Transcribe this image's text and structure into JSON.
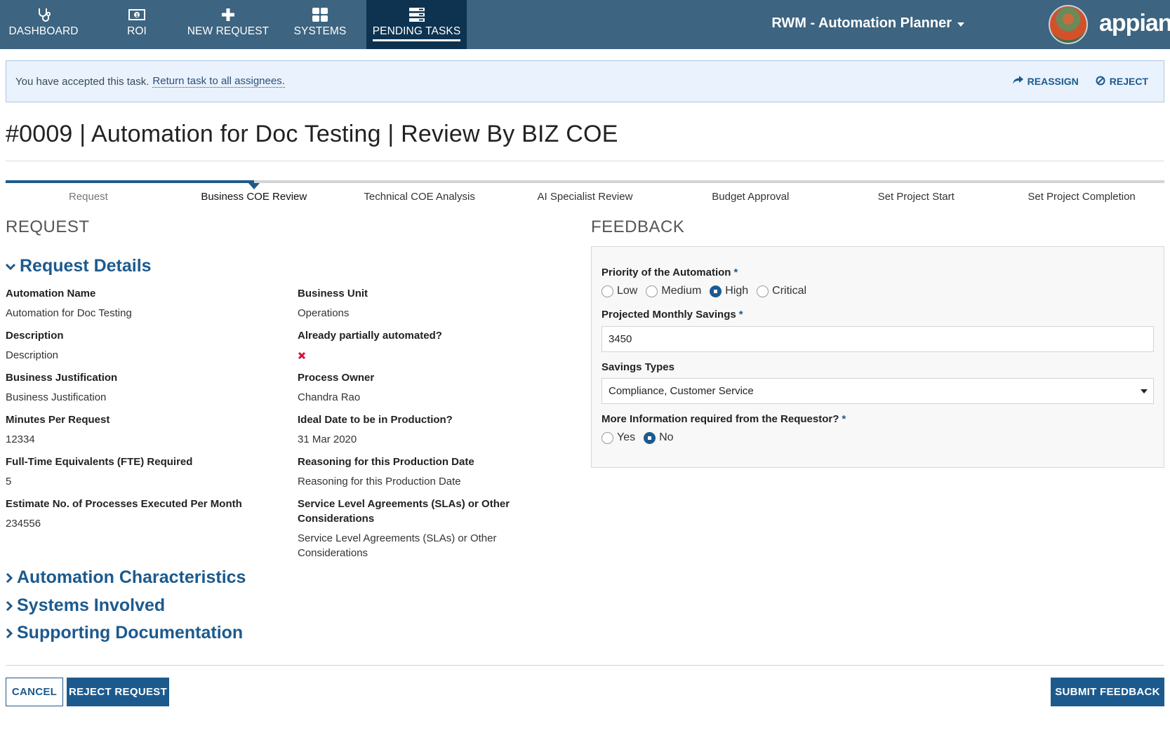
{
  "nav": {
    "tabs": [
      {
        "label": "DASHBOARD",
        "icon": "stethoscope-icon",
        "active": false
      },
      {
        "label": "ROI",
        "icon": "money-icon",
        "active": false
      },
      {
        "label": "NEW REQUEST",
        "icon": "plus-icon",
        "active": false
      },
      {
        "label": "SYSTEMS",
        "icon": "grid-icon",
        "active": false
      },
      {
        "label": "PENDING TASKS",
        "icon": "tasks-list-icon",
        "active": true
      }
    ],
    "app_title": "RWM - Automation Planner",
    "logo": "appian"
  },
  "banner": {
    "text": "You have accepted this task.",
    "link": "Return task to all assignees.",
    "reassign": "REASSIGN",
    "reject": "REJECT"
  },
  "page_title": "#0009 | Automation for Doc Testing | Review By BIZ COE",
  "steps": {
    "items": [
      "Request",
      "Business COE Review",
      "Technical COE Analysis",
      "AI Specialist Review",
      "Budget Approval",
      "Set Project Start",
      "Set Project Completion"
    ],
    "current_index": 1
  },
  "request": {
    "heading": "REQUEST",
    "details_heading": "Request Details",
    "left_fields": [
      {
        "label": "Automation Name",
        "value": "Automation for Doc Testing"
      },
      {
        "label": "Description",
        "value": "Description"
      },
      {
        "label": "Business Justification",
        "value": "Business Justification"
      },
      {
        "label": "Minutes Per Request",
        "value": "12334"
      },
      {
        "label": "Full-Time Equivalents (FTE) Required",
        "value": "5"
      },
      {
        "label": "Estimate No. of Processes Executed Per Month",
        "value": "234556"
      }
    ],
    "right_fields": [
      {
        "label": "Business Unit",
        "value": "Operations"
      },
      {
        "label": "Already partially automated?",
        "value": "",
        "icon": "red-x-icon",
        "icon_color": "#d4123a"
      },
      {
        "label": "Process Owner",
        "value": "Chandra Rao"
      },
      {
        "label": "Ideal Date to be in Production?",
        "value": "31 Mar 2020"
      },
      {
        "label": "Reasoning for this Production Date",
        "value": "Reasoning for this Production Date"
      },
      {
        "label": "Service Level Agreements (SLAs) or Other Considerations",
        "value": "Service Level Agreements (SLAs) or Other Considerations"
      }
    ],
    "collapsed_sections": [
      "Automation Characteristics",
      "Systems Involved",
      "Supporting Documentation"
    ]
  },
  "feedback": {
    "heading": "FEEDBACK",
    "priority": {
      "label": "Priority of the Automation",
      "required": "*",
      "options": [
        "Low",
        "Medium",
        "High",
        "Critical"
      ],
      "selected": "High"
    },
    "savings": {
      "label": "Projected Monthly Savings",
      "required": "*",
      "value": "3450"
    },
    "savings_types": {
      "label": "Savings Types",
      "value": "Compliance, Customer Service"
    },
    "more_info": {
      "label": "More Information required from the Requestor?",
      "required": "*",
      "options": [
        "Yes",
        "No"
      ],
      "selected": "No"
    }
  },
  "footer": {
    "cancel": "CANCEL",
    "reject_request": "REJECT REQUEST",
    "submit": "SUBMIT FEEDBACK"
  },
  "colors": {
    "nav_bg": "#3d6480",
    "nav_active": "#0d3350",
    "accent": "#1c5a8e",
    "banner_bg": "#e9f2fd",
    "error": "#d4123a"
  }
}
